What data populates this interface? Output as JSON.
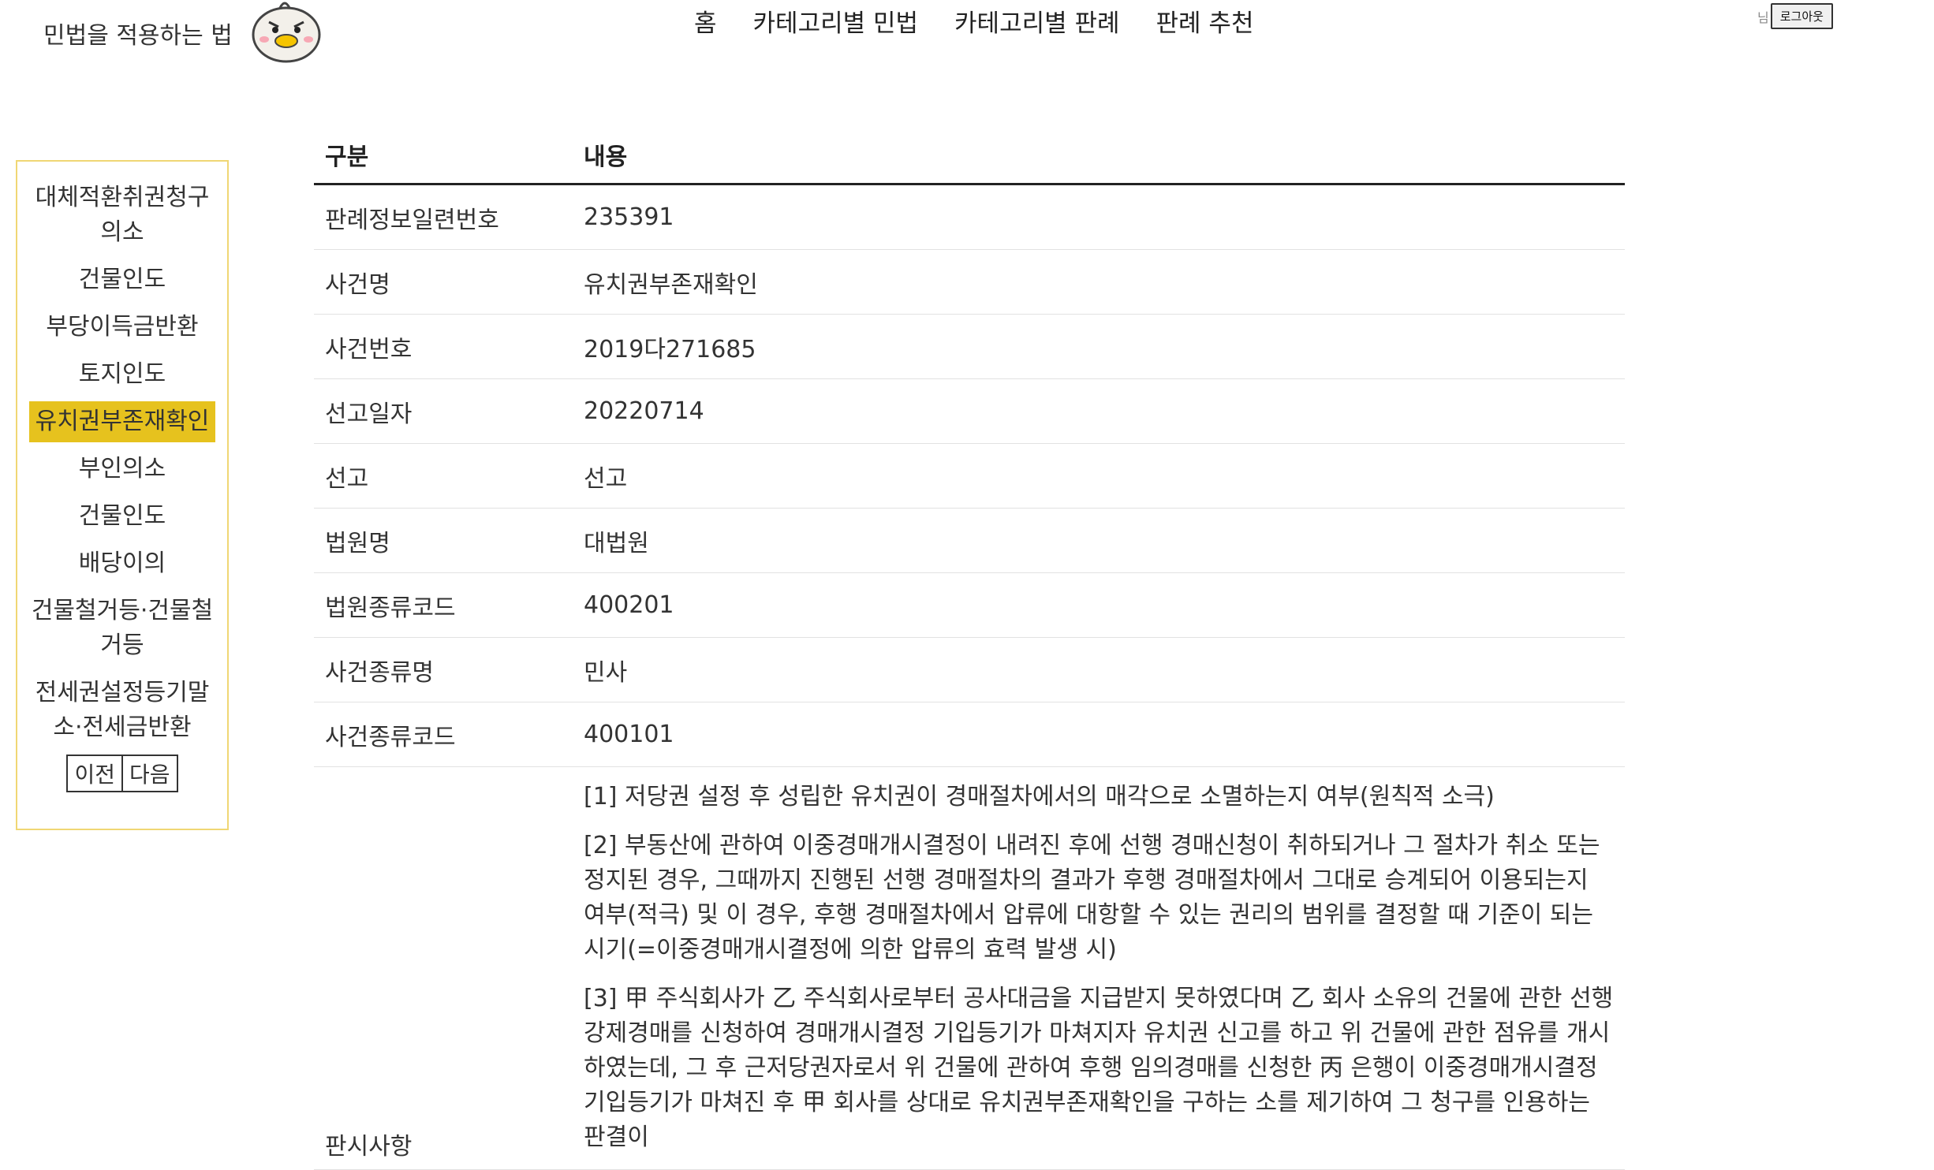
{
  "header": {
    "brand_title": "민법을 적용하는 법",
    "nav": [
      "홈",
      "카테고리별 민법",
      "카테고리별 판례",
      "판례 추천"
    ],
    "user_suffix": "님",
    "logout_label": "로그아웃"
  },
  "sidebar": {
    "items": [
      "대체적환취권청구의소",
      "건물인도",
      "부당이득금반환",
      "토지인도",
      "유치권부존재확인",
      "부인의소",
      "건물인도",
      "배당이의",
      "건물철거등·건물철거등",
      "전세권설정등기말소·전세금반환"
    ],
    "active_index": 4,
    "prev_label": "이전",
    "next_label": "다음"
  },
  "table": {
    "headers": [
      "구분",
      "내용"
    ],
    "rows": [
      {
        "key": "판례정보일련번호",
        "value": "235391"
      },
      {
        "key": "사건명",
        "value": "유치권부존재확인"
      },
      {
        "key": "사건번호",
        "value": "2019다271685"
      },
      {
        "key": "선고일자",
        "value": "20220714"
      },
      {
        "key": "선고",
        "value": "선고"
      },
      {
        "key": "법원명",
        "value": "대법원"
      },
      {
        "key": "법원종류코드",
        "value": "400201"
      },
      {
        "key": "사건종류명",
        "value": "민사"
      },
      {
        "key": "사건종류코드",
        "value": "400101"
      }
    ],
    "summary": {
      "key": "판시사항",
      "paragraphs": [
        "[1] 저당권 설정 후 성립한 유치권이 경매절차에서의 매각으로 소멸하는지 여부(원칙적 소극)",
        "[2] 부동산에 관하여 이중경매개시결정이 내려진 후에 선행 경매신청이 취하되거나 그 절차가 취소 또는 정지된 경우, 그때까지 진행된 선행 경매절차의 결과가 후행 경매절차에서 그대로 승계되어 이용되는지 여부(적극) 및 이 경우, 후행 경매절차에서 압류에 대항할 수 있는 권리의 범위를 결정할 때 기준이 되는 시기(=이중경매개시결정에 의한 압류의 효력 발생 시)",
        "[3] 甲 주식회사가 乙 주식회사로부터 공사대금을 지급받지 못하였다며 乙 회사 소유의 건물에 관한 선행 강제경매를 신청하여 경매개시결정 기입등기가 마쳐지자 유치권 신고를 하고 위 건물에 관한 점유를 개시하였는데, 그 후 근저당권자로서 위 건물에 관하여 후행 임의경매를 신청한 丙 은행이 이중경매개시결정 기입등기가 마쳐진 후 甲 회사를 상대로 유치권부존재확인을 구하는 소를 제기하여 그 청구를 인용하는 판결이"
      ]
    }
  }
}
